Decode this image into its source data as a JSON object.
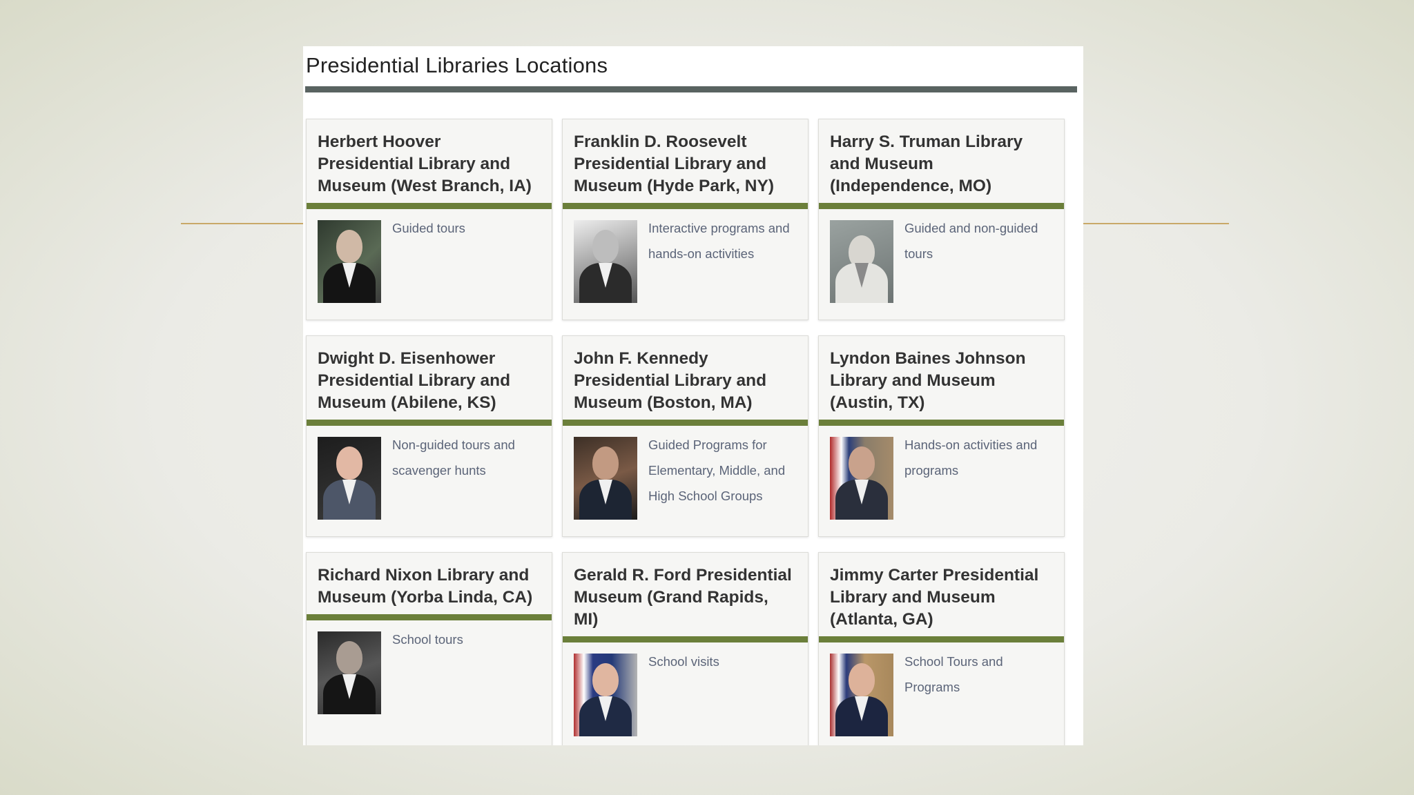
{
  "page": {
    "title": "Presidential Libraries Locations"
  },
  "libraries": [
    {
      "name": "Herbert Hoover Presidential Library and Museum (West Branch, IA)",
      "description": "Guided tours",
      "portrait_icon": "president-portrait-icon"
    },
    {
      "name": "Franklin D. Roosevelt Presidential Library and Museum (Hyde Park, NY)",
      "description": "Interactive programs and hands-on activities",
      "portrait_icon": "president-portrait-icon"
    },
    {
      "name": "Harry S. Truman Library and Museum (Independence, MO)",
      "description": "Guided and non-guided tours",
      "portrait_icon": "president-portrait-icon"
    },
    {
      "name": "Dwight D. Eisenhower Presidential Library and Museum (Abilene, KS)",
      "description": "Non-guided tours and scavenger hunts",
      "portrait_icon": "president-portrait-icon"
    },
    {
      "name": "John F. Kennedy Presidential Library and Museum (Boston, MA)",
      "description": "Guided Programs for Elementary, Middle, and High School Groups",
      "portrait_icon": "president-portrait-icon"
    },
    {
      "name": "Lyndon Baines Johnson Library and Museum (Austin, TX)",
      "description": "Hands-on activities and programs",
      "portrait_icon": "president-portrait-icon"
    },
    {
      "name": "Richard Nixon Library and Museum (Yorba Linda, CA)",
      "description": "School tours",
      "portrait_icon": "president-portrait-icon"
    },
    {
      "name": "Gerald R. Ford Presidential Museum (Grand Rapids, MI)",
      "description": "School visits",
      "portrait_icon": "president-portrait-icon"
    },
    {
      "name": "Jimmy Carter Presidential Library and Museum (Atlanta, GA)",
      "description": "School Tours and Programs",
      "portrait_icon": "president-portrait-icon"
    }
  ],
  "colors": {
    "title_rule": "#596361",
    "card_accent": "#6b7f3a",
    "decor_line": "#c9a868",
    "description_text": "#5b6478"
  }
}
